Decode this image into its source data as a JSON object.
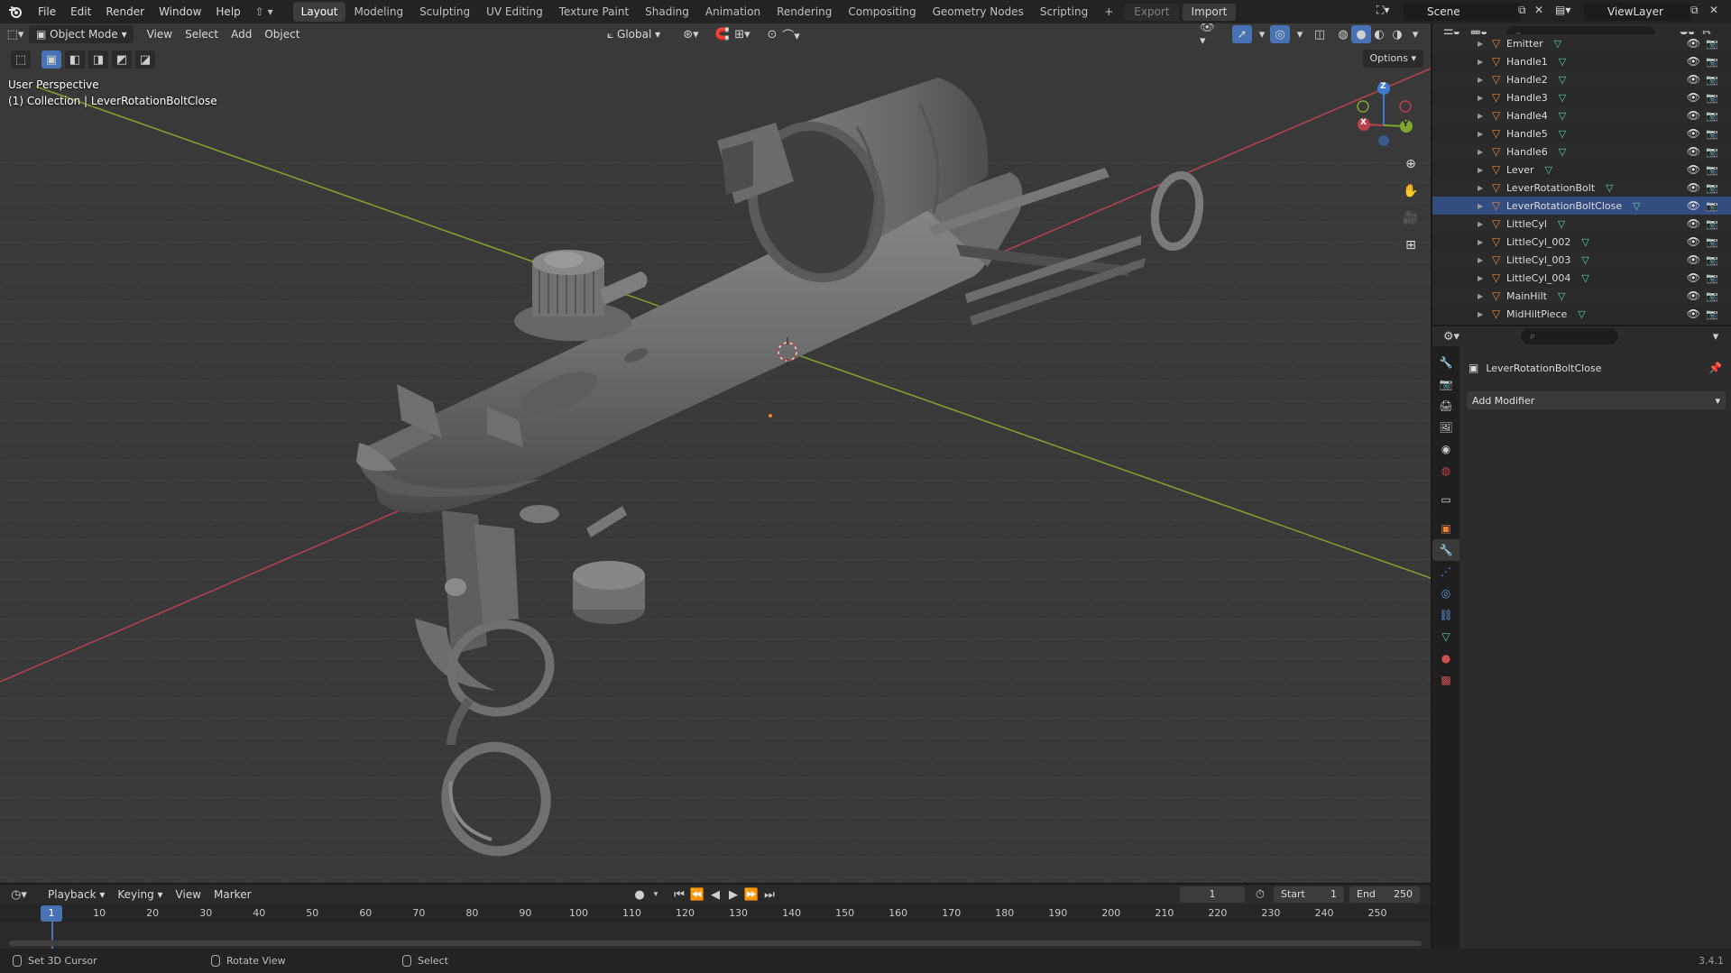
{
  "topbar": {
    "menus": [
      "File",
      "Edit",
      "Render",
      "Window",
      "Help"
    ],
    "workspaces": [
      "Layout",
      "Modeling",
      "Sculpting",
      "UV Editing",
      "Texture Paint",
      "Shading",
      "Animation",
      "Rendering",
      "Compositing",
      "Geometry Nodes",
      "Scripting"
    ],
    "active_workspace": "Layout",
    "add_tab": "+",
    "export_label": "Export",
    "import_label": "Import",
    "scene_name": "Scene",
    "view_layer": "ViewLayer"
  },
  "viewport": {
    "mode": "Object Mode",
    "menus": [
      "View",
      "Select",
      "Add",
      "Object"
    ],
    "transform_orientation": "Global",
    "options_label": "Options",
    "perspective_label": "User Perspective",
    "collection_label": "(1) Collection | LeverRotationBoltClose",
    "gizmo_axes": {
      "x": "X",
      "y": "Y",
      "z": "Z"
    }
  },
  "outliner": {
    "items": [
      {
        "name": "Emitter",
        "selected": false
      },
      {
        "name": "Handle1",
        "selected": false
      },
      {
        "name": "Handle2",
        "selected": false
      },
      {
        "name": "Handle3",
        "selected": false
      },
      {
        "name": "Handle4",
        "selected": false
      },
      {
        "name": "Handle5",
        "selected": false
      },
      {
        "name": "Handle6",
        "selected": false
      },
      {
        "name": "Lever",
        "selected": false
      },
      {
        "name": "LeverRotationBolt",
        "selected": false
      },
      {
        "name": "LeverRotationBoltClose",
        "selected": true
      },
      {
        "name": "LittleCyl",
        "selected": false
      },
      {
        "name": "LittleCyl_002",
        "selected": false
      },
      {
        "name": "LittleCyl_003",
        "selected": false
      },
      {
        "name": "LittleCyl_004",
        "selected": false
      },
      {
        "name": "MainHilt",
        "selected": false
      },
      {
        "name": "MidHiltPiece",
        "selected": false
      }
    ]
  },
  "properties": {
    "object_name": "LeverRotationBoltClose",
    "add_modifier_label": "Add Modifier",
    "tabs": [
      "tool",
      "render",
      "output",
      "view-layer",
      "scene",
      "world",
      "collection",
      "object",
      "modifiers",
      "particles",
      "physics",
      "constraints",
      "data",
      "material",
      "texture"
    ],
    "active_tab": "modifiers"
  },
  "timeline": {
    "menus": [
      "Playback",
      "Keying",
      "View",
      "Marker"
    ],
    "current_frame": "1",
    "start_label": "Start",
    "start_value": "1",
    "end_label": "End",
    "end_value": "250",
    "ticks": [
      "10",
      "20",
      "30",
      "40",
      "50",
      "60",
      "70",
      "80",
      "90",
      "100",
      "110",
      "120",
      "130",
      "140",
      "150",
      "160",
      "170",
      "180",
      "190",
      "200",
      "210",
      "220",
      "230",
      "240",
      "250"
    ]
  },
  "statusbar": {
    "hint1": "Set 3D Cursor",
    "hint2": "Rotate View",
    "hint3": "Select",
    "version": "3.4.1"
  },
  "colors": {
    "accent": "#4772b3",
    "selected_row": "#334d80",
    "x_axis": "#b8424c",
    "y_axis": "#7fa52e",
    "z_axis": "#3d7ad4",
    "object_icon": "#e8853a",
    "mesh_icon": "#5fd0a0"
  }
}
